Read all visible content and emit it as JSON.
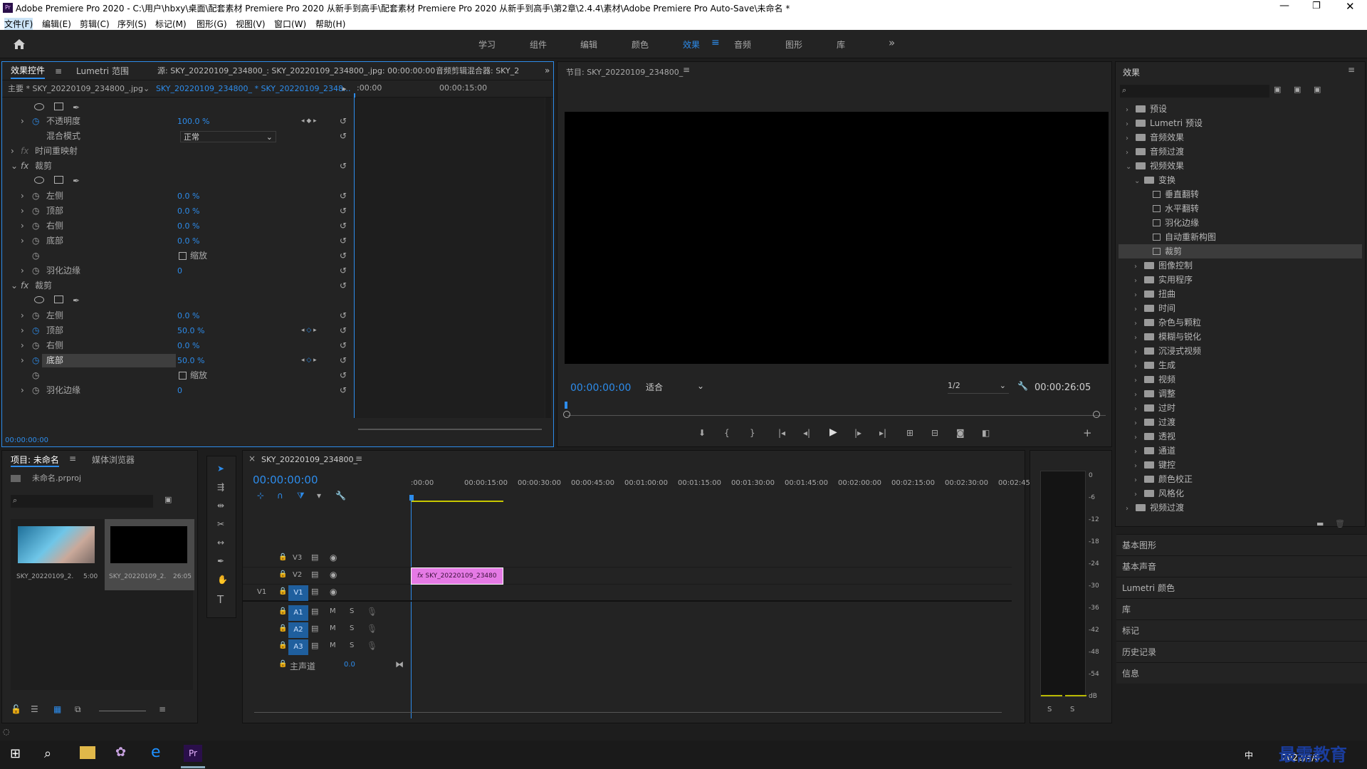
{
  "window": {
    "title": "Adobe Premiere Pro 2020 - C:\\用户\\hbxy\\桌面\\配套素材 Premiere Pro 2020 从新手到高手\\配套素材 Premiere Pro 2020 从新手到高手\\第2章\\2.4.4\\素材\\Adobe Premiere Pro Auto-Save\\未命名 *"
  },
  "menu": [
    "文件(F)",
    "编辑(E)",
    "剪辑(C)",
    "序列(S)",
    "标记(M)",
    "图形(G)",
    "视图(V)",
    "窗口(W)",
    "帮助(H)"
  ],
  "workspaces": {
    "items": [
      "学习",
      "组件",
      "编辑",
      "颜色",
      "效果",
      "音频",
      "图形",
      "库"
    ],
    "active": "效果"
  },
  "effect_controls": {
    "tabs": [
      "效果控件",
      "Lumetri 范围",
      "源: SKY_20220109_234800_: SKY_20220109_234800_.jpg: 00:00:00:00",
      "音频剪辑混合器: SKY_2"
    ],
    "master": "主要 * SKY_20220109_234800_.jpg",
    "clip": "SKY_20220109_234800_ * SKY_20220109_2348...",
    "ruler_start": ":00:00",
    "ruler_mid": "00:00:15:00",
    "rows": [
      {
        "label": "不透明度",
        "value": "100.0 %",
        "level": 1
      },
      {
        "label": "混合模式",
        "value": "正常",
        "level": 1
      },
      {
        "label": "时间重映射",
        "value": "",
        "level": 0
      },
      {
        "label": "裁剪",
        "value": "",
        "level": 0
      },
      {
        "label": "左侧",
        "value": "0.0 %",
        "level": 1
      },
      {
        "label": "顶部",
        "value": "0.0 %",
        "level": 1
      },
      {
        "label": "右侧",
        "value": "0.0 %",
        "level": 1
      },
      {
        "label": "底部",
        "value": "0.0 %",
        "level": 1
      },
      {
        "label": "",
        "value": "缩放",
        "level": 1
      },
      {
        "label": "羽化边缘",
        "value": "0",
        "level": 1
      },
      {
        "label": "裁剪",
        "value": "",
        "level": 0
      },
      {
        "label": "左侧",
        "value": "0.0 %",
        "level": 1
      },
      {
        "label": "顶部",
        "value": "50.0 %",
        "level": 1
      },
      {
        "label": "右侧",
        "value": "0.0 %",
        "level": 1
      },
      {
        "label": "底部",
        "value": "50.0 %",
        "level": 1
      },
      {
        "label": "",
        "value": "缩放",
        "level": 1
      },
      {
        "label": "羽化边缘",
        "value": "0",
        "level": 1
      }
    ],
    "timecode": "00:00:00:00"
  },
  "program": {
    "title": "节目: SKY_20220109_234800_",
    "timecode": "00:00:00:00",
    "fit": "适合",
    "quality": "1/2",
    "duration": "00:00:26:05"
  },
  "effects_panel": {
    "title": "效果",
    "tree": [
      {
        "label": "预设",
        "depth": 0,
        "kind": "folder",
        "open": false
      },
      {
        "label": "Lumetri 预设",
        "depth": 0,
        "kind": "folder",
        "open": false
      },
      {
        "label": "音频效果",
        "depth": 0,
        "kind": "folder",
        "open": false
      },
      {
        "label": "音频过渡",
        "depth": 0,
        "kind": "folder",
        "open": false
      },
      {
        "label": "视频效果",
        "depth": 0,
        "kind": "folder",
        "open": true
      },
      {
        "label": "变换",
        "depth": 1,
        "kind": "folder",
        "open": true
      },
      {
        "label": "垂直翻转",
        "depth": 2,
        "kind": "fx"
      },
      {
        "label": "水平翻转",
        "depth": 2,
        "kind": "fx"
      },
      {
        "label": "羽化边缘",
        "depth": 2,
        "kind": "fx"
      },
      {
        "label": "自动重新构图",
        "depth": 2,
        "kind": "fx"
      },
      {
        "label": "裁剪",
        "depth": 2,
        "kind": "fx",
        "selected": true
      },
      {
        "label": "图像控制",
        "depth": 1,
        "kind": "folder"
      },
      {
        "label": "实用程序",
        "depth": 1,
        "kind": "folder"
      },
      {
        "label": "扭曲",
        "depth": 1,
        "kind": "folder"
      },
      {
        "label": "时间",
        "depth": 1,
        "kind": "folder"
      },
      {
        "label": "杂色与颗粒",
        "depth": 1,
        "kind": "folder"
      },
      {
        "label": "模糊与锐化",
        "depth": 1,
        "kind": "folder"
      },
      {
        "label": "沉浸式视频",
        "depth": 1,
        "kind": "folder"
      },
      {
        "label": "生成",
        "depth": 1,
        "kind": "folder"
      },
      {
        "label": "视频",
        "depth": 1,
        "kind": "folder"
      },
      {
        "label": "调整",
        "depth": 1,
        "kind": "folder"
      },
      {
        "label": "过时",
        "depth": 1,
        "kind": "folder"
      },
      {
        "label": "过渡",
        "depth": 1,
        "kind": "folder"
      },
      {
        "label": "透视",
        "depth": 1,
        "kind": "folder"
      },
      {
        "label": "通道",
        "depth": 1,
        "kind": "folder"
      },
      {
        "label": "键控",
        "depth": 1,
        "kind": "folder"
      },
      {
        "label": "颜色校正",
        "depth": 1,
        "kind": "folder"
      },
      {
        "label": "风格化",
        "depth": 1,
        "kind": "folder"
      },
      {
        "label": "视频过渡",
        "depth": 0,
        "kind": "folder"
      }
    ],
    "collapsed": [
      "基本图形",
      "基本声音",
      "Lumetri 颜色",
      "库",
      "标记",
      "历史记录",
      "信息"
    ]
  },
  "project": {
    "tabs": [
      "项目: 未命名",
      "媒体浏览器"
    ],
    "file": "未命名.prproj",
    "items": [
      {
        "name": "SKY_20220109_2...",
        "duration": "5:00"
      },
      {
        "name": "SKY_20220109_2...",
        "duration": "26:05"
      }
    ]
  },
  "timeline": {
    "title": "SKY_20220109_234800_",
    "timecode": "00:00:00:00",
    "ruler": [
      ":00:00",
      "00:00:15:00",
      "00:00:30:00",
      "00:00:45:00",
      "00:01:00:00",
      "00:01:15:00",
      "00:01:30:00",
      "00:01:45:00",
      "00:02:00:00",
      "00:02:15:00",
      "00:02:30:00",
      "00:02:45:"
    ],
    "video_tracks": [
      "V3",
      "V2",
      "V1"
    ],
    "audio_tracks": [
      "A1",
      "A2",
      "A3"
    ],
    "master": "主声道",
    "master_value": "0.0",
    "clip": "SKY_20220109_23480",
    "src_v1": "V1"
  },
  "meter": {
    "scale": [
      "0",
      "-6",
      "-12",
      "-18",
      "-24",
      "-30",
      "-36",
      "-42",
      "-48",
      "-54",
      "dB"
    ],
    "buttons": [
      "S",
      "S"
    ]
  },
  "taskbar": {
    "date": "2022/4/6",
    "ime": "中",
    "watermark": "最需教育"
  }
}
